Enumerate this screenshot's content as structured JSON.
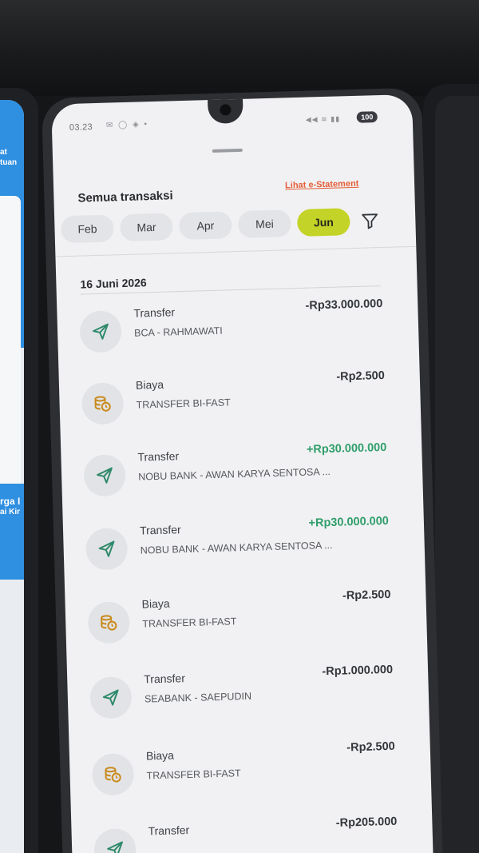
{
  "status_bar": {
    "time": "03.23",
    "battery": "100"
  },
  "header": {
    "title": "Semua transaksi",
    "estatement_link": "Lihat e-Statement"
  },
  "months": [
    {
      "label": "Feb",
      "active": false
    },
    {
      "label": "Mar",
      "active": false
    },
    {
      "label": "Apr",
      "active": false
    },
    {
      "label": "Mei",
      "active": false
    },
    {
      "label": "Jun",
      "active": true
    }
  ],
  "date_group": "16 Juni 2026",
  "transactions": [
    {
      "type": "Transfer",
      "description": "BCA - RAHMAWATI",
      "amount": "-Rp33.000.000",
      "direction": "debit",
      "icon": "send-icon"
    },
    {
      "type": "Biaya",
      "description": "TRANSFER BI-FAST",
      "amount": "-Rp2.500",
      "direction": "debit",
      "icon": "fee-coins-icon"
    },
    {
      "type": "Transfer",
      "description": "NOBU BANK - AWAN KARYA SENTOSA ...",
      "amount": "+Rp30.000.000",
      "direction": "credit",
      "icon": "send-icon"
    },
    {
      "type": "Transfer",
      "description": "NOBU BANK - AWAN KARYA SENTOSA ...",
      "amount": "+Rp30.000.000",
      "direction": "credit",
      "icon": "send-icon"
    },
    {
      "type": "Biaya",
      "description": "TRANSFER BI-FAST",
      "amount": "-Rp2.500",
      "direction": "debit",
      "icon": "fee-coins-icon"
    },
    {
      "type": "Transfer",
      "description": "SEABANK - SAEPUDIN",
      "amount": "-Rp1.000.000",
      "direction": "debit",
      "icon": "send-icon"
    },
    {
      "type": "Biaya",
      "description": "TRANSFER BI-FAST",
      "amount": "-Rp2.500",
      "direction": "debit",
      "icon": "fee-coins-icon"
    },
    {
      "type": "Transfer",
      "description": "",
      "amount": "-Rp205.000",
      "direction": "debit",
      "icon": "send-icon"
    }
  ],
  "colors": {
    "active_month": "#c4d327",
    "credit": "#2f9e6a",
    "link": "#e4603a",
    "fee_icon": "#c98a1c"
  },
  "background_apps": {
    "left_text_1": "at",
    "left_text_2": "tuan",
    "left_text_3": "rga I",
    "left_text_4": "ai Kir"
  }
}
